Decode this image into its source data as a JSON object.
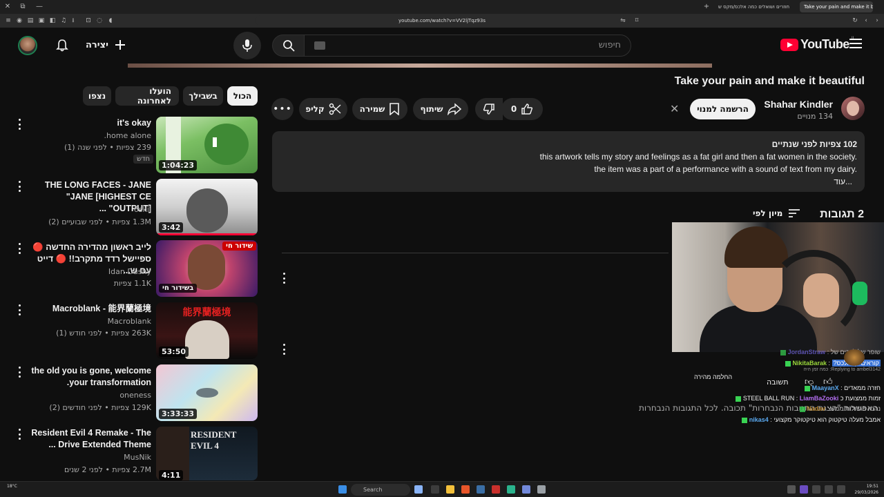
{
  "browser": {
    "tabs": [
      {
        "label": "חוזרים ושואלים כמה אלכס/מקס ש"
      },
      {
        "label": "Take your pain and make it beau"
      }
    ],
    "url": "youtube.com/watch?v=VV2ljTqz93s"
  },
  "header": {
    "search_placeholder": "חיפוש",
    "create_label": "יצירה",
    "logo_text": "YouTube",
    "logo_country": "IL"
  },
  "video": {
    "title": "Take your pain and make it beautiful",
    "channel_name": "Shahar Kindler",
    "subscribers": "134 מנויים",
    "subscribe_label": "הרשמה למנוי",
    "like_count": "0",
    "share_label": "שיתוף",
    "save_label": "שמירה",
    "clip_label": "קליפ"
  },
  "description": {
    "meta": "102 צפיות  לפני שנתיים",
    "line1": "this artwork tells my story and feelings as a fat girl and then a fat  women in the society.",
    "line2": "the item was a part of a performance with a sound of text from my dairy.",
    "more": "...עוד"
  },
  "comments": {
    "count": "2 תגובות",
    "sort_label": "מיון לפי",
    "permission_text": "האפשרות \"הצגת התגובות הנבחרות\" תכובה. לכל התגובות הנבחרות",
    "reply_label": "תשובה"
  },
  "chat": [
    {
      "user": "JordanStraw",
      "message": "שופר של לייבים של"
    },
    {
      "user": "NikitaBarak",
      "message": "קוראים לך אלכס?"
    },
    {
      "user": "",
      "message": "Replying to ambel3142: כמה זמן היה"
    },
    {
      "user": "",
      "message": "החלמה מהירה"
    },
    {
      "user": "MaayanX",
      "message": "חזרה ממאדים"
    },
    {
      "user": "LiamBaZooki",
      "message": "זמות ממצועת כ STEEL BALL RUN"
    },
    {
      "user": "Nadav",
      "message": "נהנה הגדולות ממש"
    },
    {
      "user": "nikas4",
      "message": "אמבל מעלה טיקטוק הוא טיקטוקר מקצועי"
    }
  ],
  "chips": [
    {
      "label": "הכול",
      "active": true
    },
    {
      "label": "בשבילך",
      "active": false
    },
    {
      "label": "הועלו לאחרונה",
      "active": false
    },
    {
      "label": "נצפו",
      "active": false
    }
  ],
  "related": [
    {
      "title": "it's okay",
      "channel": "home alone.",
      "meta": "239 צפיות • לפני שנה (1)",
      "duration": "1:04:23",
      "badge": "חדש",
      "live": false
    },
    {
      "title": "THE LONG FACES - JANE \"JANE [HIGHEST CE OUTPUT]\" ...",
      "channel": "6skii",
      "meta": "1.3M צפיות • לפני שבועיים (2)",
      "duration": "3:42",
      "badge": "",
      "live": false
    },
    {
      "title": "לייב ראשון מהדירה החדשה 🔴 ספיישל רדד מתקרב!! 🔴 דייט עם ש...",
      "channel": "Idan Dushy",
      "meta": "1.1K צפיות",
      "duration": "",
      "badge": "",
      "live": true,
      "live_badge": "שידור חי",
      "live_tag": "בשידור חי"
    },
    {
      "title": "Macroblank - 能界蘭極境",
      "channel": "Macroblank",
      "meta": "263K צפיות • לפני חודש (1)",
      "duration": "53:50",
      "badge": "",
      "live": false
    },
    {
      "title": "the old you is gone, welcome your transformation.",
      "channel": "oneness",
      "meta": "129K צפיות • לפני חודשים (2)",
      "duration": "3:33:33",
      "badge": "",
      "live": false
    },
    {
      "title": "Resident Evil 4 Remake - The Drive Extended Theme ...",
      "channel": "MusNik",
      "meta": "2.7M צפיות • לפני 2 שנים",
      "duration": "4:11",
      "badge": "",
      "live": false
    }
  ],
  "taskbar": {
    "search_label": "Search",
    "time": "19:51",
    "date": "29/03/2026",
    "weather": "18°C"
  },
  "colors": {
    "accent_red": "#ff0033",
    "background": "#0f0f0f",
    "chip_bg": "#272727",
    "chat_highlight": "#3b74d6"
  }
}
